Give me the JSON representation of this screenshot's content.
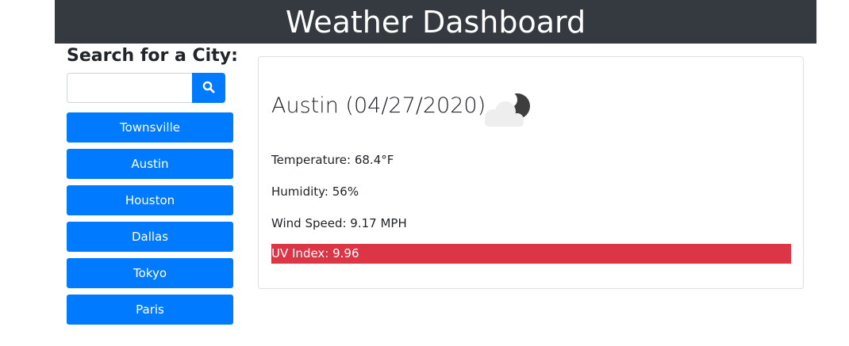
{
  "header": {
    "title": "Weather Dashboard"
  },
  "search": {
    "label": "Search for a City:",
    "value": "",
    "placeholder": "",
    "button_icon": "search-icon"
  },
  "cities": [
    "Townsville",
    "Austin",
    "Houston",
    "Dallas",
    "Tokyo",
    "Paris"
  ],
  "current": {
    "title": "Austin (04/27/2020)",
    "icon": "cloudy-night-icon",
    "temperature": "Temperature: 68.4°F",
    "humidity": "Humidity: 56%",
    "wind": "Wind Speed: 9.17 MPH",
    "uv": "UV Index: 9.96"
  },
  "colors": {
    "header_bg": "#343a40",
    "accent": "#007bff",
    "uv_severe": "#dc3545"
  }
}
